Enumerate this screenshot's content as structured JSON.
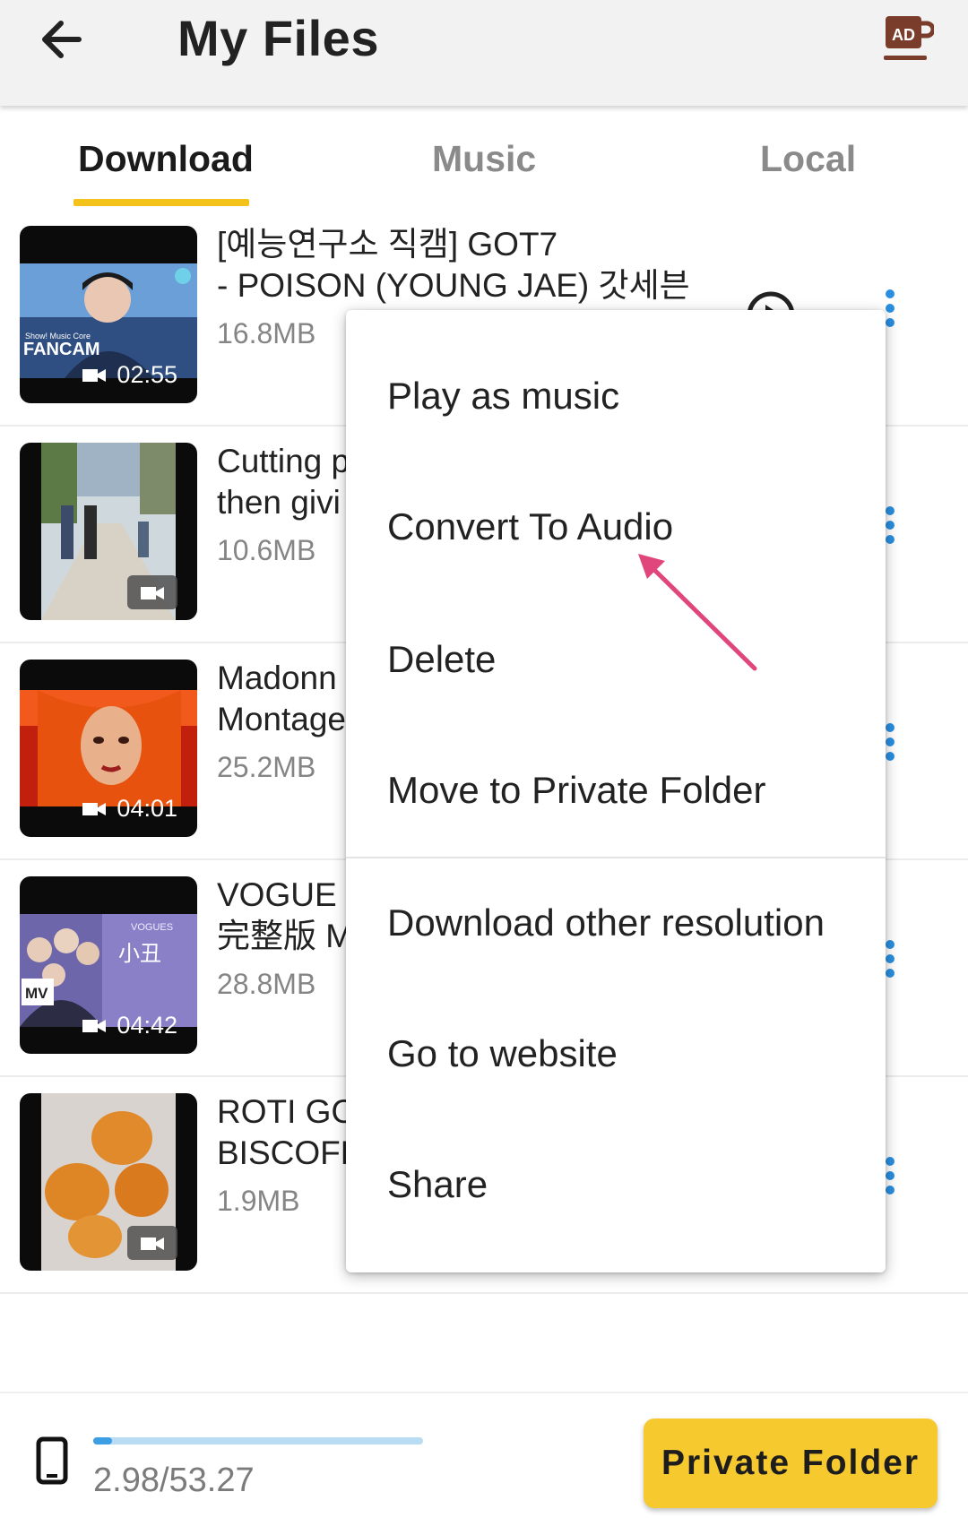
{
  "header": {
    "title": "My Files",
    "back_icon": "arrow-left-icon",
    "ad_label": "AD"
  },
  "tabs": [
    {
      "label": "Download",
      "active": true
    },
    {
      "label": "Music",
      "active": false
    },
    {
      "label": "Local",
      "active": false
    }
  ],
  "files": [
    {
      "title": "[예능연구소 직캠] GOT7\n- POISON (YOUNG JAE) 갓세븐",
      "size": "16.8MB",
      "duration": "02:55",
      "overlay_text": "FANCAM",
      "overlay_subtext": "Show! Music Core"
    },
    {
      "title": "Cutting p\nthen givi",
      "size": "10.6MB",
      "duration": ""
    },
    {
      "title": "Madonn\nMontage",
      "size": "25.2MB",
      "duration": "04:01"
    },
    {
      "title": "VOGUE 5\n完整版 M",
      "size": "28.8MB",
      "duration": "04:42",
      "overlay_text": "MV",
      "overlay_subtext": "VOGUES"
    },
    {
      "title": "ROTI GO\nBISCOFF",
      "size": "1.9MB",
      "duration": ""
    }
  ],
  "context_menu": {
    "items": [
      "Play as music",
      "Convert To Audio",
      "Delete",
      "Move to Private Folder",
      "Download other resolution",
      "Go to website",
      "Share"
    ]
  },
  "annotation": {
    "color": "#e0457b"
  },
  "footer": {
    "storage_text": "2.98/53.27",
    "storage_fraction": 0.056,
    "private_folder_label": "Private Folder"
  },
  "colors": {
    "accent": "#f3c31b",
    "button": "#f6c92f",
    "more_dots": "#2a8fe0",
    "storage_track": "#b9dcf4"
  }
}
